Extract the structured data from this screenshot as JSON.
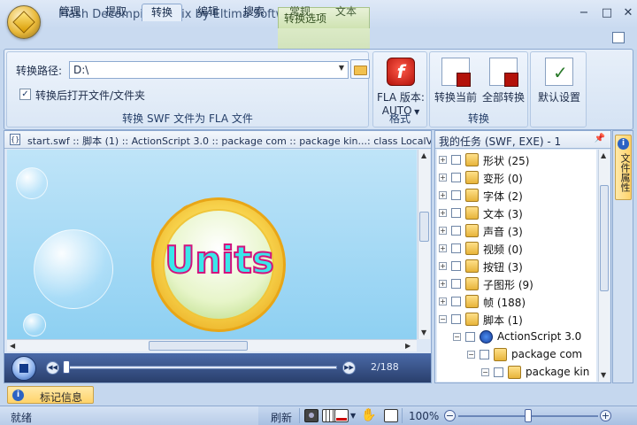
{
  "window": {
    "title": "Flash Decompiler Trillix by Eltima Software",
    "context_tab_title": "转换选项",
    "min_icon": "minimize-icon",
    "max_icon": "maximize-icon",
    "close_icon": "close-icon"
  },
  "ribbon": {
    "tabs": [
      {
        "label": "管理"
      },
      {
        "label": "提取"
      },
      {
        "label": "转换",
        "active": true
      },
      {
        "label": "编辑"
      },
      {
        "label": "搜索"
      },
      {
        "label": "常规"
      },
      {
        "label": "文本"
      }
    ],
    "convert_group": {
      "path_label": "转换路径:",
      "path_value": "D:\\",
      "open_after_label": "转换后打开文件/文件夹",
      "open_after_checked": true,
      "group_label": "转换 SWF 文件为 FLA 文件"
    },
    "format_group": {
      "fla_version_label": "FLA 版本:",
      "fla_version_value": "AUTO",
      "group_label": "格式"
    },
    "convert_buttons_group": {
      "convert_current": "转换当前",
      "convert_all": "全部转换",
      "default_settings": "默认设置",
      "group_label": "转换"
    }
  },
  "document": {
    "tab_text": "start.swf :: 脚本 (1) :: ActionScript 3.0 :: package com :: package kin...: class LocalValidate",
    "stage_text": "Units",
    "player": {
      "frame_counter": "2/188"
    }
  },
  "info_tab": {
    "label": "标记信息"
  },
  "tasks_panel": {
    "title": "我的任务 (SWF, EXE) - 1",
    "items": [
      {
        "label": "形状 (25)",
        "icon": "folder-icon",
        "expander": "+",
        "indent": 0
      },
      {
        "label": "变形 (0)",
        "icon": "folder-icon",
        "expander": "+",
        "indent": 0
      },
      {
        "label": "字体 (2)",
        "icon": "folder-icon",
        "expander": "+",
        "indent": 0
      },
      {
        "label": "文本 (3)",
        "icon": "folder-icon",
        "expander": "+",
        "indent": 0
      },
      {
        "label": "声音 (3)",
        "icon": "folder-icon",
        "expander": "+",
        "indent": 0
      },
      {
        "label": "视频 (0)",
        "icon": "folder-icon",
        "expander": "+",
        "indent": 0
      },
      {
        "label": "按钮 (3)",
        "icon": "folder-icon",
        "expander": "+",
        "indent": 0
      },
      {
        "label": "子图形 (9)",
        "icon": "folder-icon",
        "expander": "+",
        "indent": 0
      },
      {
        "label": "帧 (188)",
        "icon": "folder-icon",
        "expander": "+",
        "indent": 0
      },
      {
        "label": "脚本 (1)",
        "icon": "folder-icon",
        "expander": "−",
        "indent": 0
      },
      {
        "label": "ActionScript 3.0",
        "icon": "actionscript-icon",
        "expander": "−",
        "indent": 1
      },
      {
        "label": "package com",
        "icon": "package-icon",
        "expander": "−",
        "indent": 2
      },
      {
        "label": "package kin",
        "icon": "package-icon",
        "expander": "−",
        "indent": 3
      }
    ]
  },
  "side_panel": {
    "label": "文件属性"
  },
  "status": {
    "left_text": "就绪",
    "refresh_label": "刷新",
    "zoom_level": "100%"
  }
}
